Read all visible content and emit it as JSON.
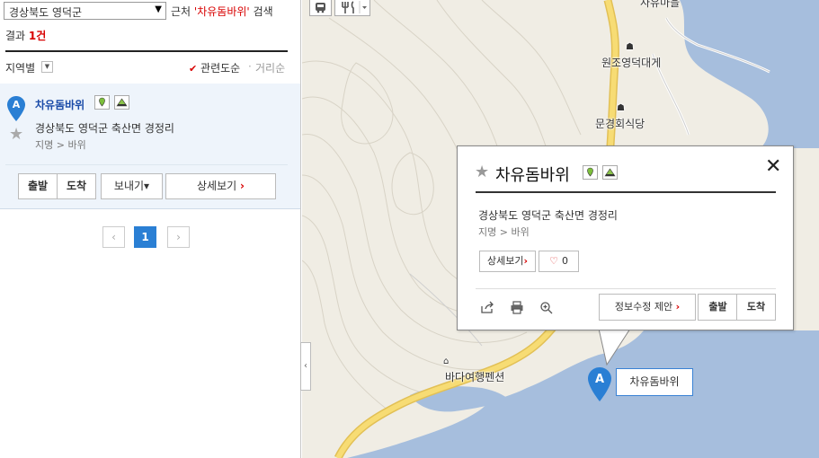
{
  "search": {
    "region": "경상북도 영덕군",
    "near_prefix": "근처",
    "keyword_quoted": "'차유돔바위'",
    "search_word": "검색",
    "result_prefix": "결과",
    "result_count": "1건"
  },
  "filter": {
    "region_label": "지역별",
    "sort_relevance": "관련도순",
    "sort_separator": "·",
    "sort_distance": "거리순"
  },
  "result": {
    "marker_letter": "A",
    "title": "차유돔바위",
    "address": "경상북도 영덕군 축산면 경정리",
    "category": "지명 > 바위",
    "btn_start": "출발",
    "btn_end": "도착",
    "btn_send": "보내기",
    "send_arrow": "▾",
    "btn_detail": "상세보기",
    "chevron": "›"
  },
  "pagination": {
    "prev": "‹",
    "current": "1",
    "next": "›"
  },
  "map": {
    "labels": {
      "top_partial": "사유마을",
      "place1": "원조영덕대게",
      "place2": "문경회식당",
      "place3": "바다여행펜션"
    },
    "tool_icons": [
      "bus-icon",
      "restaurant-icon",
      "dropdown-icon"
    ],
    "colors": {
      "sea": "#a6bedd",
      "land": "#f0ede4",
      "road": "#f4d66a",
      "accent": "#2a7fd4",
      "chevron": "#d80000"
    }
  },
  "popup": {
    "title": "차유돔바위",
    "address": "경상북도 영덕군 축산면 경정리",
    "category": "지명 > 바위",
    "btn_detail": "상세보기",
    "like_count": "0",
    "btn_suggest": "정보수정 제안",
    "btn_start": "출발",
    "btn_end": "도착",
    "close_symbol": "✕"
  },
  "pin": {
    "letter": "A",
    "label": "차유돔바위"
  },
  "icons": {
    "star": "☆",
    "star_filled": "★",
    "check": "✔",
    "heart": "♡",
    "dropdown": "▾"
  }
}
